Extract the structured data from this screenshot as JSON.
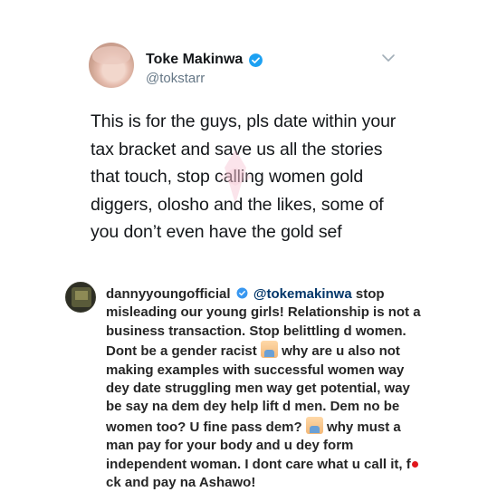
{
  "tweet": {
    "display_name": "Toke Makinwa",
    "handle": "@tokstarr",
    "text": "This is for the guys, pls date within your tax bracket and save us all the stories that touch, stop calling women gold diggers, olosho and the likes, some of you don’t even have the gold sef",
    "verified_color": "#1da1f2"
  },
  "comment": {
    "username": "dannyyoungofficial",
    "mention": "@tokemakinwa",
    "part1": "stop misleading our young girls! Relationship is not a business transaction. Stop belittling d women. Dont be a gender racist",
    "part2": "why are u also not making examples with successful women way dey date struggling men way get potential, way be say na dem dey help lift d men. Dem no be women too? U fine pass dem?",
    "part3": "why must a man pay for your body and u dey form independent woman. I dont care what u call it, f",
    "part4": "ck and pay na Ashawo!",
    "verified_color": "#3897f0",
    "mention_color": "#003569"
  }
}
